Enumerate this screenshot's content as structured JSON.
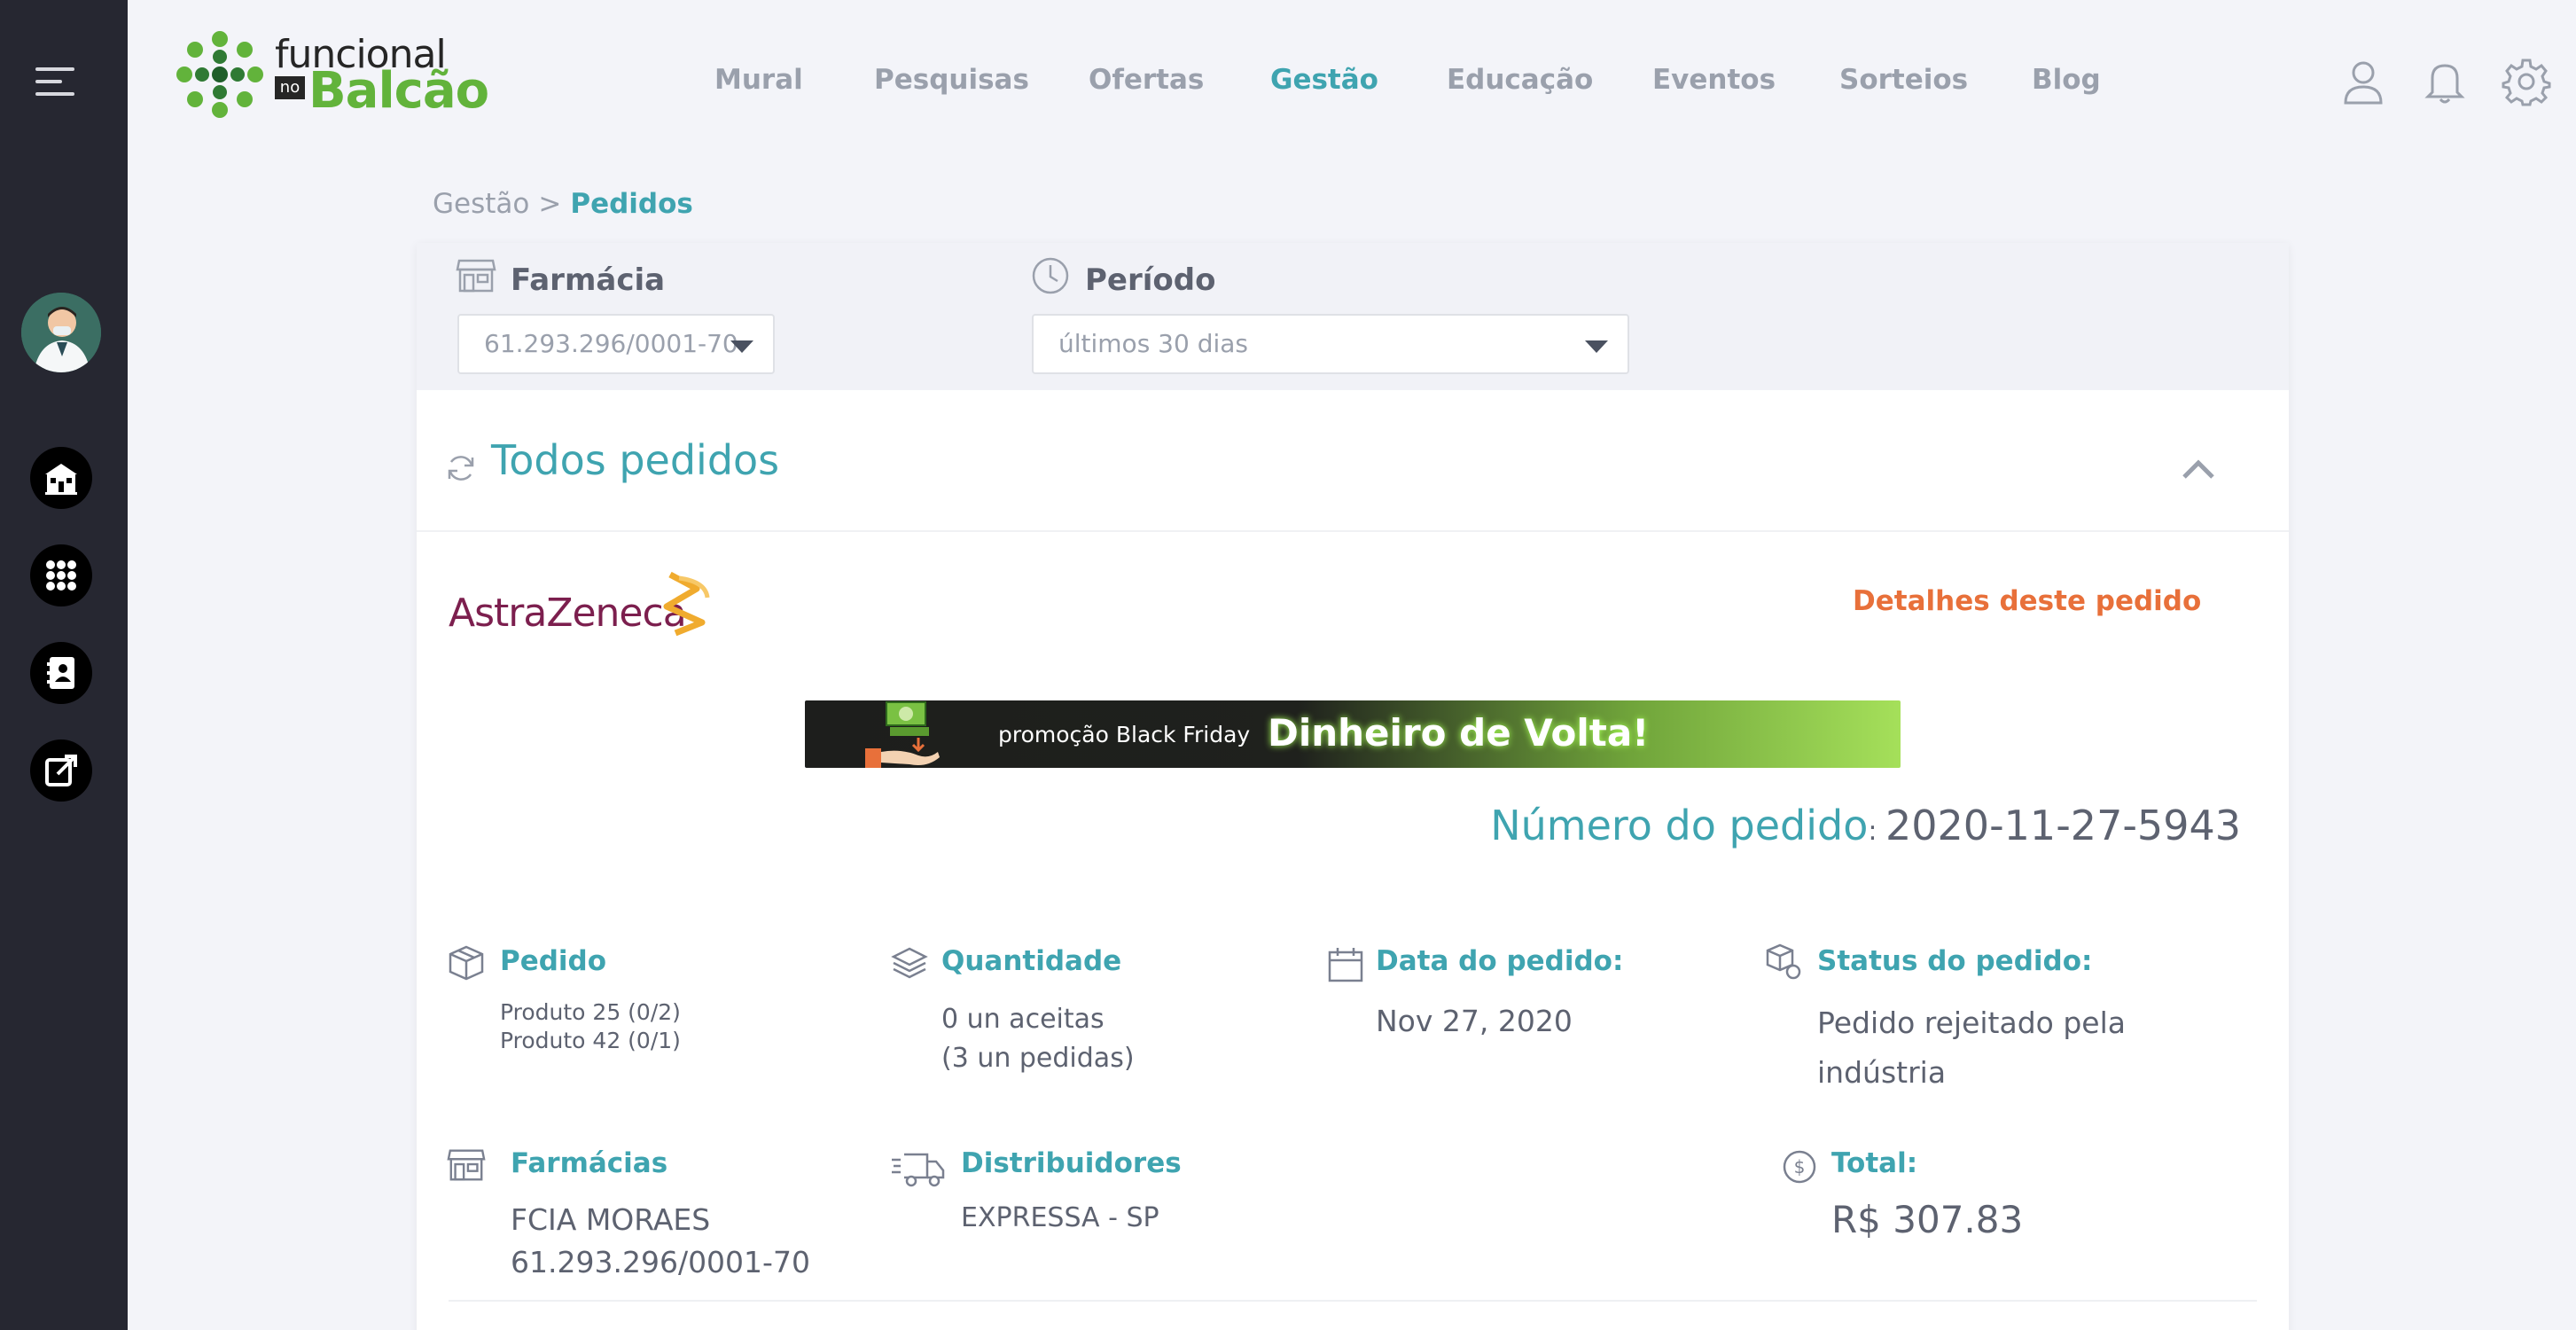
{
  "logo": {
    "line1": "funcional",
    "no": "no",
    "line2": "Balcão"
  },
  "nav": [
    {
      "label": "Mural"
    },
    {
      "label": "Pesquisas"
    },
    {
      "label": "Ofertas"
    },
    {
      "label": "Gestão",
      "active": true
    },
    {
      "label": "Educação"
    },
    {
      "label": "Eventos"
    },
    {
      "label": "Sorteios"
    },
    {
      "label": "Blog"
    }
  ],
  "breadcrumb": {
    "parent": "Gestão",
    "separator": ">",
    "current": "Pedidos"
  },
  "filters": {
    "farmacia": {
      "label": "Farmácia",
      "value": "61.293.296/0001-70"
    },
    "periodo": {
      "label": "Período",
      "value": "últimos 30 dias"
    }
  },
  "section": {
    "title": "Todos pedidos"
  },
  "order": {
    "brand": "AstraZeneca",
    "details_link": "Detalhes deste pedido",
    "banner": {
      "small": "promoção Black Friday",
      "big": "Dinheiro de Volta!"
    },
    "number_label": "Número do pedido",
    "number_sep": ": ",
    "number_value": "2020-11-27-5943",
    "pedido": {
      "label": "Pedido",
      "items": [
        "Produto 25 (0/2)",
        "Produto 42 (0/1)"
      ]
    },
    "quantidade": {
      "label": "Quantidade",
      "line1": "0 un aceitas",
      "line2": "(3 un pedidas)"
    },
    "data": {
      "label": "Data do pedido:",
      "value": "Nov 27, 2020"
    },
    "status": {
      "label": "Status do pedido:",
      "line1": "Pedido rejeitado pela",
      "line2": "indústria"
    },
    "farmacias": {
      "label": "Farmácias",
      "line1": "FCIA MORAES",
      "line2": "61.293.296/0001-70"
    },
    "distribuidores": {
      "label": "Distribuidores",
      "value": "EXPRESSA - SP"
    },
    "total": {
      "label": "Total:",
      "value": "R$ 307.83"
    }
  },
  "colors": {
    "accent": "#3fa4b0",
    "link": "#e8703a",
    "sidebar": "#262731",
    "brand_green": "#62b33b"
  }
}
